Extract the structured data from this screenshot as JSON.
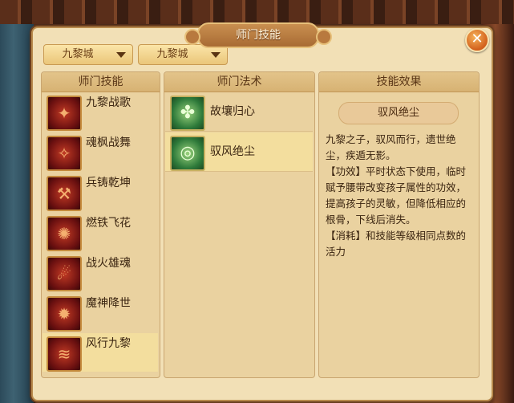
{
  "window": {
    "title": "师门技能",
    "close_icon": "✕"
  },
  "filters": {
    "sect_1": "九黎城",
    "sect_2": "九黎城"
  },
  "skills_panel": {
    "header": "师门技能",
    "items": [
      {
        "label": "九黎战歌",
        "icon": "battle-song-icon",
        "glyph": "✦"
      },
      {
        "label": "魂枫战舞",
        "icon": "maple-dance-icon",
        "glyph": "✧"
      },
      {
        "label": "兵铸乾坤",
        "icon": "forge-icon",
        "glyph": "⚒"
      },
      {
        "label": "燃铁飞花",
        "icon": "burning-iron-icon",
        "glyph": "✺"
      },
      {
        "label": "战火雄魂",
        "icon": "war-fire-icon",
        "glyph": "☄"
      },
      {
        "label": "魔神降世",
        "icon": "demon-god-icon",
        "glyph": "✹"
      },
      {
        "label": "风行九黎",
        "icon": "wind-walk-icon",
        "glyph": "≋"
      }
    ],
    "selected_index": 6
  },
  "spells_panel": {
    "header": "师门法术",
    "items": [
      {
        "label": "故壤归心",
        "icon": "spiral-icon",
        "glyph": "✤"
      },
      {
        "label": "驭风绝尘",
        "icon": "whirlwind-icon",
        "glyph": "◎"
      }
    ],
    "selected_index": 1
  },
  "effect_panel": {
    "header": "技能效果",
    "name": "驭风绝尘",
    "description": [
      "九黎之子，驭风而行，遗世绝尘，疾遁无影。",
      "【功效】平时状态下使用，临时赋予腰带改变孩子属性的功效，提高孩子的灵敏，但降低相应的根骨，下线后消失。",
      "【消耗】和技能等级相同点数的活力"
    ]
  }
}
